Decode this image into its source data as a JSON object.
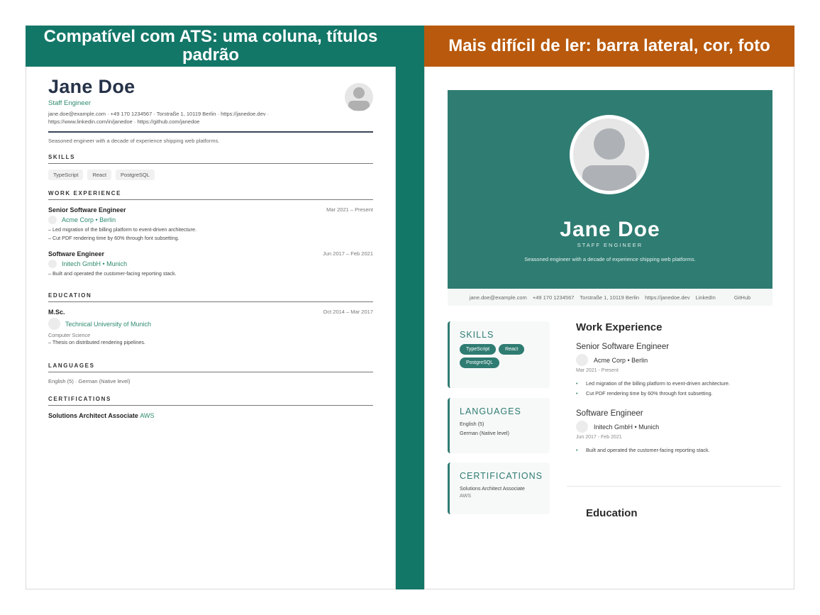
{
  "left_panel": {
    "heading": "Compatível com ATS: uma coluna, títulos padrão",
    "resume": {
      "name": "Jane Doe",
      "role": "Staff Engineer",
      "contact_line1": "jane.doe@example.com  ·  +49 170 1234567  ·  Torstraße 1, 10119 Berlin  ·  https://janedoe.dev  ·",
      "contact_line2": "https://www.linkedin.com/in/janedoe  ·  https://github.com/janedoe",
      "summary": "Seasoned engineer with a decade of experience shipping web platforms.",
      "sections": {
        "skills": "SKILLS",
        "work": "WORK EXPERIENCE",
        "education": "EDUCATION",
        "languages": "LANGUAGES",
        "certifications": "CERTIFICATIONS"
      },
      "skills": [
        "TypeScript",
        "React",
        "PostgreSQL"
      ],
      "jobs": [
        {
          "title": "Senior Software Engineer",
          "date": "Mar 2021 – Present",
          "company": "Acme Corp • Berlin",
          "bullets": [
            "–  Led migration of the billing platform to event-driven architecture.",
            "–  Cut PDF rendering time by 60% through font subsetting."
          ]
        },
        {
          "title": "Software Engineer",
          "date": "Jun 2017 – Feb 2021",
          "company": "Initech GmbH • Munich",
          "bullets": [
            "–  Built and operated the customer-facing reporting stack."
          ]
        }
      ],
      "education": {
        "degree": "M.Sc.",
        "date": "Oct 2014 – Mar 2017",
        "school": "Technical University of Munich",
        "field": "Computer Science",
        "bullet": "–  Thesis on distributed rendering pipelines."
      },
      "languages": "English (5)  ·   German (Native level)",
      "certification": {
        "name": "Solutions Architect Associate",
        "issuer": "AWS"
      }
    }
  },
  "right_panel": {
    "heading": "Mais difícil de ler: barra lateral, cor, foto",
    "resume": {
      "name": "Jane Doe",
      "role": "STAFF ENGINEER",
      "summary": "Seasoned engineer with a decade of experience shipping web platforms.",
      "contact": [
        "jane.doe@example.com",
        "+49 170 1234567",
        "Torstraße 1, 10119 Berlin",
        "https://janedoe.dev",
        "LinkedIn",
        "GitHub"
      ],
      "skills_title": "SKILLS",
      "skills": [
        "TypeScript",
        "React",
        "PostgreSQL"
      ],
      "languages_title": "LANGUAGES",
      "languages": [
        "English (5)",
        "German (Native level)"
      ],
      "certifications_title": "CERTIFICATIONS",
      "certification": {
        "name": "Solutions Architect Associate",
        "issuer": "AWS"
      },
      "work_title": "Work Experience",
      "jobs": [
        {
          "title": "Senior Software Engineer",
          "company": "Acme Corp • Berlin",
          "date": "Mar 2021 - Present",
          "bullets": [
            "Led migration of the billing platform to event-driven architecture.",
            "Cut PDF rendering time by 60% through font subsetting."
          ]
        },
        {
          "title": "Software Engineer",
          "company": "Initech GmbH • Munich",
          "date": "Jun 2017 - Feb 2021",
          "bullets": [
            "Built and operated the customer-facing reporting stack."
          ]
        }
      ],
      "education_title": "Education"
    }
  },
  "colors": {
    "teal": "#137768",
    "orange": "#b8590d",
    "hero": "#2f7c72",
    "accent_green": "#2e8a6f"
  }
}
